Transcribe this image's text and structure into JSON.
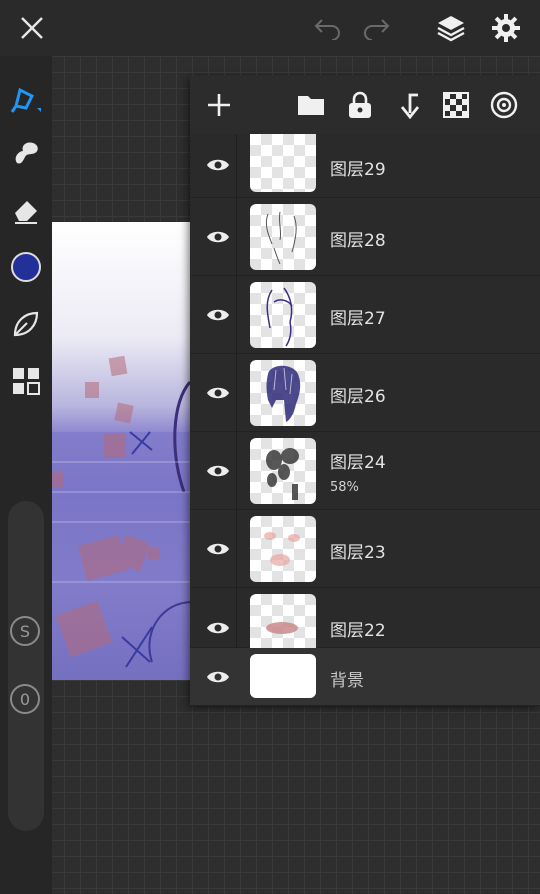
{
  "topbar": {
    "icons": [
      "close-icon",
      "undo-icon",
      "redo-icon",
      "layers-icon",
      "gear-icon"
    ]
  },
  "left_toolbar": {
    "tools": [
      "pen-tool-icon",
      "smudge-icon",
      "eraser-icon",
      "color-swatch",
      "leaf-brush-icon",
      "grid-icon"
    ],
    "current_color": "#23309a",
    "size_label": "S",
    "opacity_label": "0"
  },
  "layers_panel": {
    "toolbar_icons": [
      "add-icon",
      "folder-icon",
      "lock-icon",
      "merge-down-icon",
      "checker-icon",
      "reference-icon"
    ],
    "layers": [
      {
        "name": "图层29",
        "opacity": ""
      },
      {
        "name": "图层28",
        "opacity": ""
      },
      {
        "name": "图层27",
        "opacity": ""
      },
      {
        "name": "图层26",
        "opacity": ""
      },
      {
        "name": "图层24",
        "opacity": "58%"
      },
      {
        "name": "图层23",
        "opacity": ""
      },
      {
        "name": "图层22",
        "opacity": ""
      }
    ],
    "background_label": "背景"
  },
  "colors": {
    "accent": "#2196f3",
    "panel": "#2a2a2a"
  }
}
